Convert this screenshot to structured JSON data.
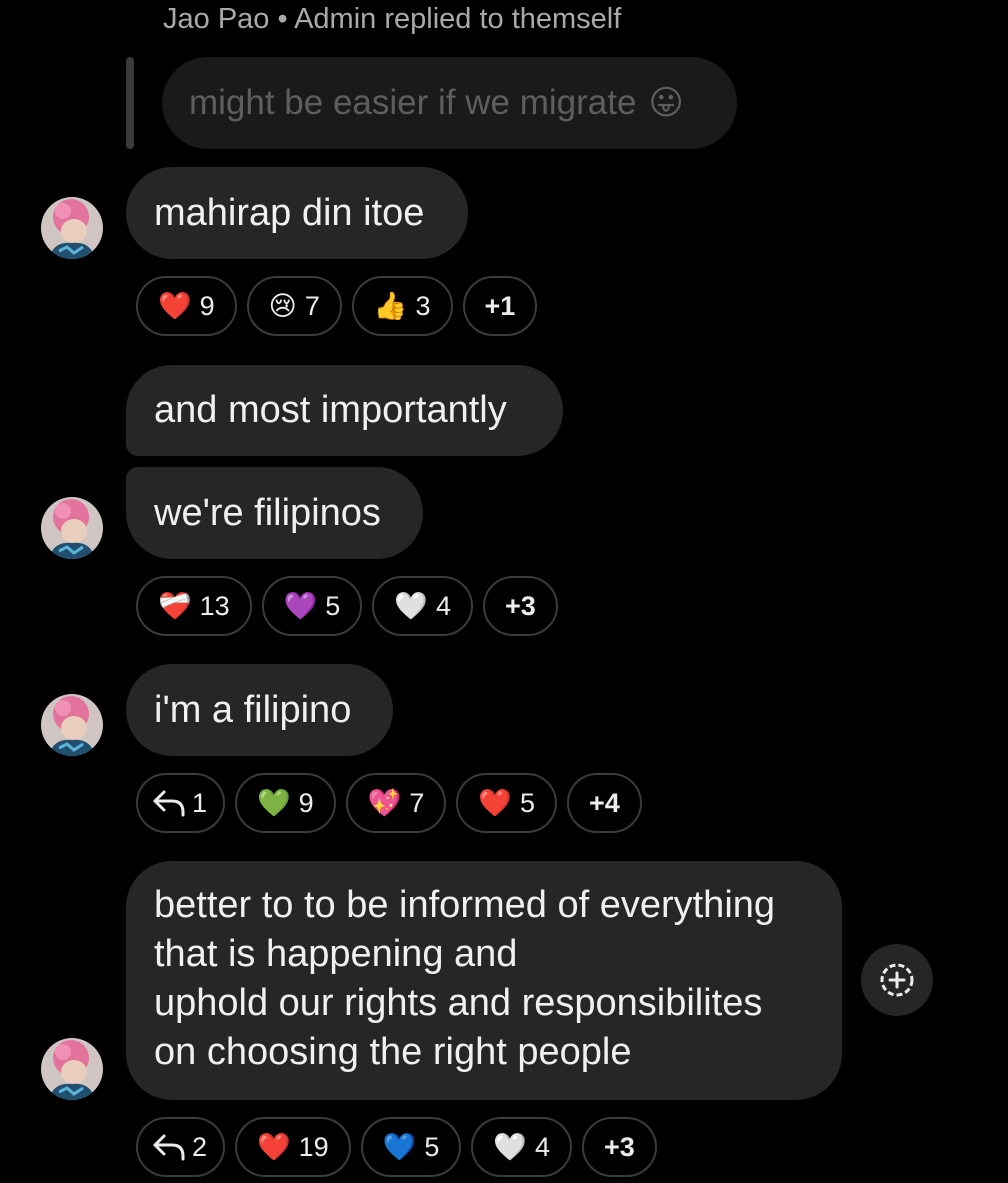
{
  "reply": {
    "header": "Jao Pao • Admin replied to themself",
    "quoted_text": "might be easier if we migrate",
    "quoted_emoji": "😛"
  },
  "messages": [
    {
      "text": "mahirap din itoe",
      "reactions": [
        {
          "emoji": "❤️",
          "count": "9"
        },
        {
          "emoji": "😢",
          "count": "7"
        },
        {
          "emoji": "👍",
          "count": "3"
        }
      ],
      "more": "+1"
    },
    {
      "text": "and most importantly"
    },
    {
      "text": "we're filipinos",
      "reactions": [
        {
          "emoji": "❤️‍🩹",
          "count": "13"
        },
        {
          "emoji": "💜",
          "count": "5"
        },
        {
          "emoji": "🤍",
          "count": "4"
        }
      ],
      "more": "+3"
    },
    {
      "text": "i'm a filipino",
      "replies": "1",
      "reactions": [
        {
          "emoji": "💚",
          "count": "9"
        },
        {
          "emoji": "💖",
          "count": "7"
        },
        {
          "emoji": "❤️",
          "count": "5"
        }
      ],
      "more": "+4"
    },
    {
      "lines": [
        "better to to be informed of everything",
        "that is happening and",
        "uphold our rights and responsibilites",
        "on choosing the right people"
      ],
      "replies": "2",
      "reactions": [
        {
          "emoji": "❤️",
          "count": "19"
        },
        {
          "emoji": "💙",
          "count": "5"
        },
        {
          "emoji": "🤍",
          "count": "4"
        }
      ],
      "more": "+3"
    }
  ],
  "icons": {
    "reply": "reply-arrow-icon",
    "add_reaction": "add-reaction-icon"
  },
  "colors": {
    "background": "#000000",
    "bubble": "#262626",
    "chip_border": "#3b3b3b",
    "muted_text": "#a9a9a9"
  }
}
